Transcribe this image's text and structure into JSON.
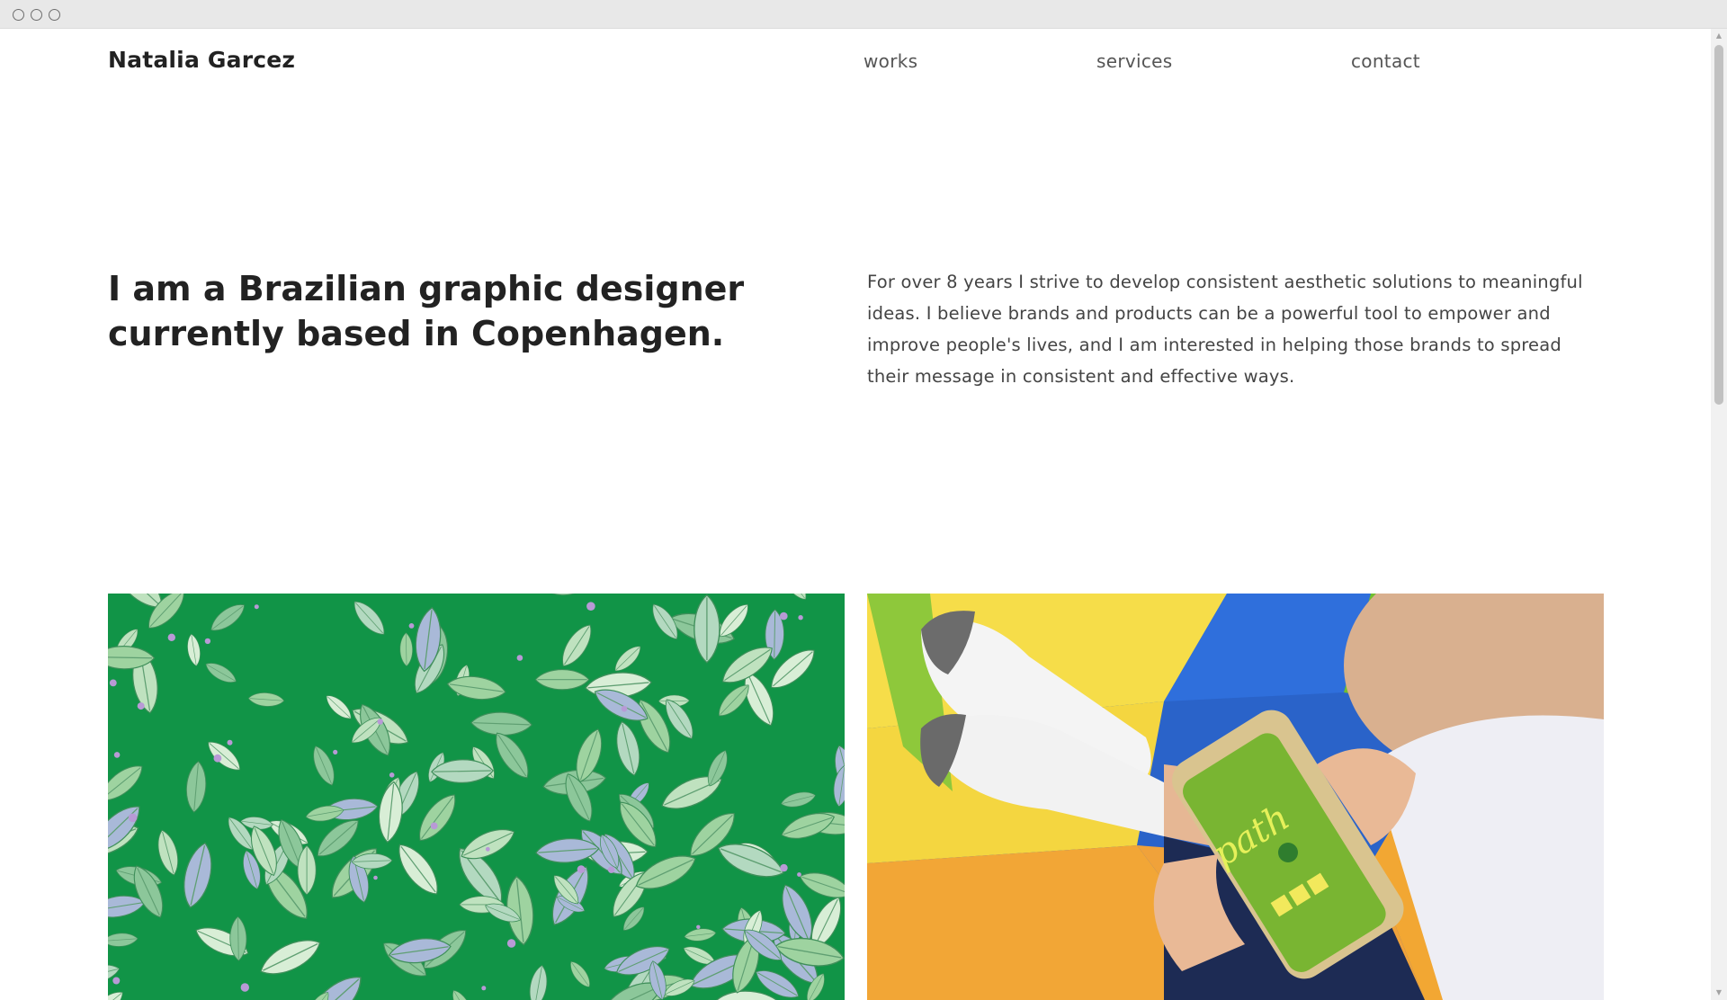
{
  "site": {
    "brand": "Natalia Garcez",
    "nav": {
      "works": "works",
      "services": "services",
      "contact": "contact"
    }
  },
  "hero": {
    "headline": "I am a Brazilian graphic designer currently based in Copenhagen.",
    "intro": "For over 8 years I strive to develop consistent aesthetic solutions to meaningful ideas. I believe brands and products can be a powerful tool to empower and improve people's lives, and I am interested in helping those brands to spread their message in consistent and effective ways."
  },
  "projects": [
    {
      "image": "green-leaf-pattern-illustration"
    },
    {
      "image": "child-playing-path-app-on-phone",
      "app_text": "path"
    }
  ],
  "colors": {
    "text": "#222222",
    "nav": "#555555",
    "leaf_bg": "#119447",
    "chrome": "#e8e8e8"
  }
}
